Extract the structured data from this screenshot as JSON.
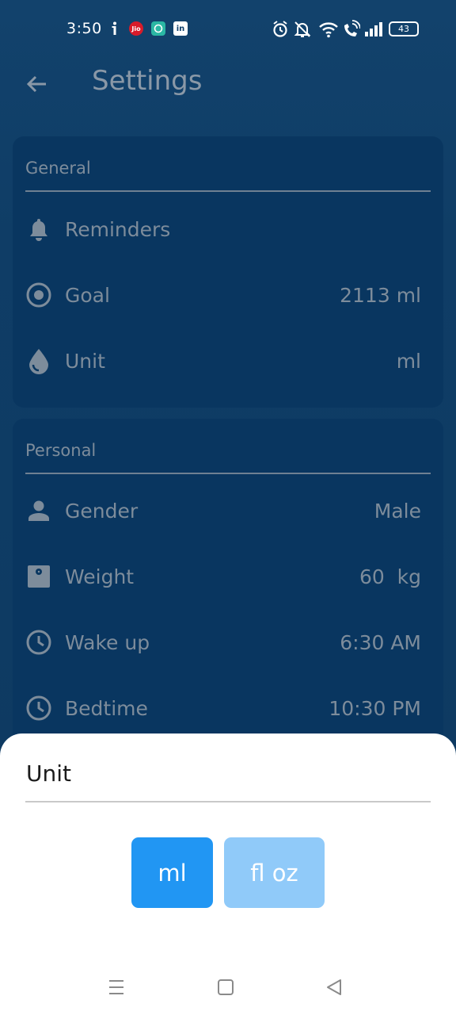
{
  "status_bar": {
    "time": "3:50",
    "battery": "43"
  },
  "header": {
    "title": "Settings"
  },
  "general": {
    "section_title": "General",
    "reminders_label": "Reminders",
    "goal_label": "Goal",
    "goal_value": "2113 ml",
    "unit_label": "Unit",
    "unit_value": "ml"
  },
  "personal": {
    "section_title": "Personal",
    "gender_label": "Gender",
    "gender_value": "Male",
    "weight_label": "Weight",
    "weight_value": "60  kg",
    "wakeup_label": "Wake up",
    "wakeup_value": "6:30 AM",
    "bedtime_label": "Bedtime",
    "bedtime_value": "10:30 PM"
  },
  "unit_sheet": {
    "title": "Unit",
    "options": [
      "ml",
      "fl oz"
    ],
    "selected": "ml"
  },
  "colors": {
    "background": "#0f3d66",
    "card": "#093660",
    "muted_text": "#7d8c9b",
    "selected_button": "#2196f3",
    "unselected_button": "#90caf9"
  },
  "icons": {
    "back": "arrow-left-icon",
    "reminders": "bell-icon",
    "goal": "target-icon",
    "unit": "drop-icon",
    "gender": "person-icon",
    "weight": "scale-icon",
    "wakeup": "clock-icon",
    "bedtime": "clock-icon"
  }
}
